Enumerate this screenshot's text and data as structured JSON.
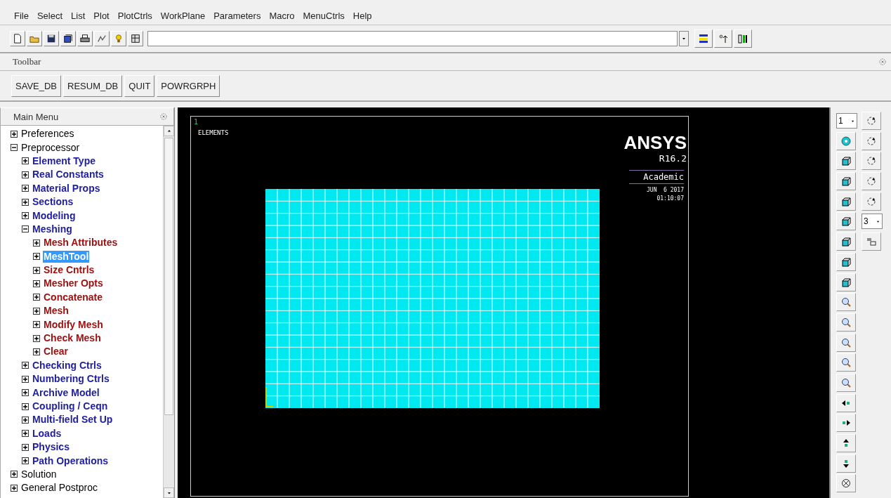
{
  "menu_bar": [
    "File",
    "Select",
    "List",
    "Plot",
    "PlotCtrls",
    "WorkPlane",
    "Parameters",
    "Macro",
    "MenuCtrls",
    "Help"
  ],
  "toolbar": {
    "title": "Toolbar",
    "buttons": [
      "SAVE_DB",
      "RESUM_DB",
      "QUIT",
      "POWRGRPH"
    ]
  },
  "main_menu": {
    "title": "Main Menu",
    "items": [
      {
        "label": "Preferences",
        "expanded": false,
        "selected": false
      },
      {
        "label": "Preprocessor",
        "expanded": true,
        "selected": false,
        "children": [
          {
            "label": "Element Type",
            "expanded": false,
            "selected": false
          },
          {
            "label": "Real Constants",
            "expanded": false,
            "selected": false
          },
          {
            "label": "Material Props",
            "expanded": false,
            "selected": false
          },
          {
            "label": "Sections",
            "expanded": false,
            "selected": false
          },
          {
            "label": "Modeling",
            "expanded": false,
            "selected": false
          },
          {
            "label": "Meshing",
            "expanded": true,
            "selected": false,
            "children": [
              {
                "label": "Mesh Attributes",
                "expanded": false,
                "selected": false
              },
              {
                "label": "MeshTool",
                "expanded": false,
                "selected": true
              },
              {
                "label": "Size Cntrls",
                "expanded": false,
                "selected": false
              },
              {
                "label": "Mesher Opts",
                "expanded": false,
                "selected": false
              },
              {
                "label": "Concatenate",
                "expanded": false,
                "selected": false
              },
              {
                "label": "Mesh",
                "expanded": false,
                "selected": false
              },
              {
                "label": "Modify Mesh",
                "expanded": false,
                "selected": false
              },
              {
                "label": "Check Mesh",
                "expanded": false,
                "selected": false
              },
              {
                "label": "Clear",
                "expanded": false,
                "selected": false
              }
            ]
          },
          {
            "label": "Checking Ctrls",
            "expanded": false,
            "selected": false
          },
          {
            "label": "Numbering Ctrls",
            "expanded": false,
            "selected": false
          },
          {
            "label": "Archive Model",
            "expanded": false,
            "selected": false
          },
          {
            "label": "Coupling / Ceqn",
            "expanded": false,
            "selected": false
          },
          {
            "label": "Multi-field Set Up",
            "expanded": false,
            "selected": false
          },
          {
            "label": "Loads",
            "expanded": false,
            "selected": false
          },
          {
            "label": "Physics",
            "expanded": false,
            "selected": false
          },
          {
            "label": "Path Operations",
            "expanded": false,
            "selected": false
          }
        ]
      },
      {
        "label": "Solution",
        "expanded": false,
        "selected": false
      },
      {
        "label": "General Postproc",
        "expanded": false,
        "selected": false
      }
    ]
  },
  "graphics": {
    "window_number": "1",
    "plot_label": "ELEMENTS",
    "brand": "ANSYS",
    "version": "R16.2",
    "license": "Academic",
    "date": "JUN  6 2017",
    "time": "01:10:07"
  },
  "view_toolbar": {
    "window_select": "1",
    "rotation_increment": "3"
  }
}
